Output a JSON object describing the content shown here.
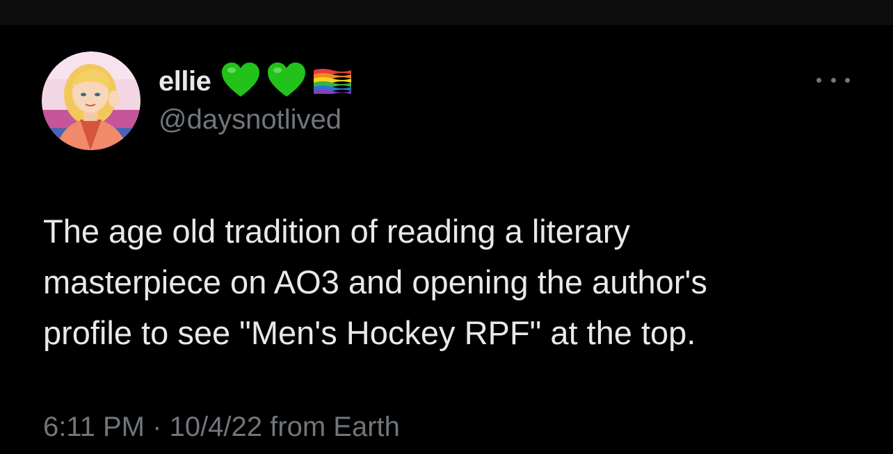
{
  "tweet": {
    "author": {
      "display_name": "ellie",
      "handle": "@daysnotlived",
      "badges": [
        "green-heart-icon",
        "green-heart-icon",
        "rainbow-flag-icon"
      ]
    },
    "text_lines": [
      "The age old tradition of reading a literary",
      "masterpiece on AO3 and opening the author's",
      "profile to see \"Men's Hockey RPF\" at the top."
    ],
    "timestamp": "6:11 PM",
    "separator": "·",
    "date": "10/4/22",
    "source": "from Earth"
  },
  "colors": {
    "background": "#000000",
    "primary_text": "#e7e9ea",
    "secondary_text": "#71767b",
    "heart_green": "#22c21a"
  }
}
